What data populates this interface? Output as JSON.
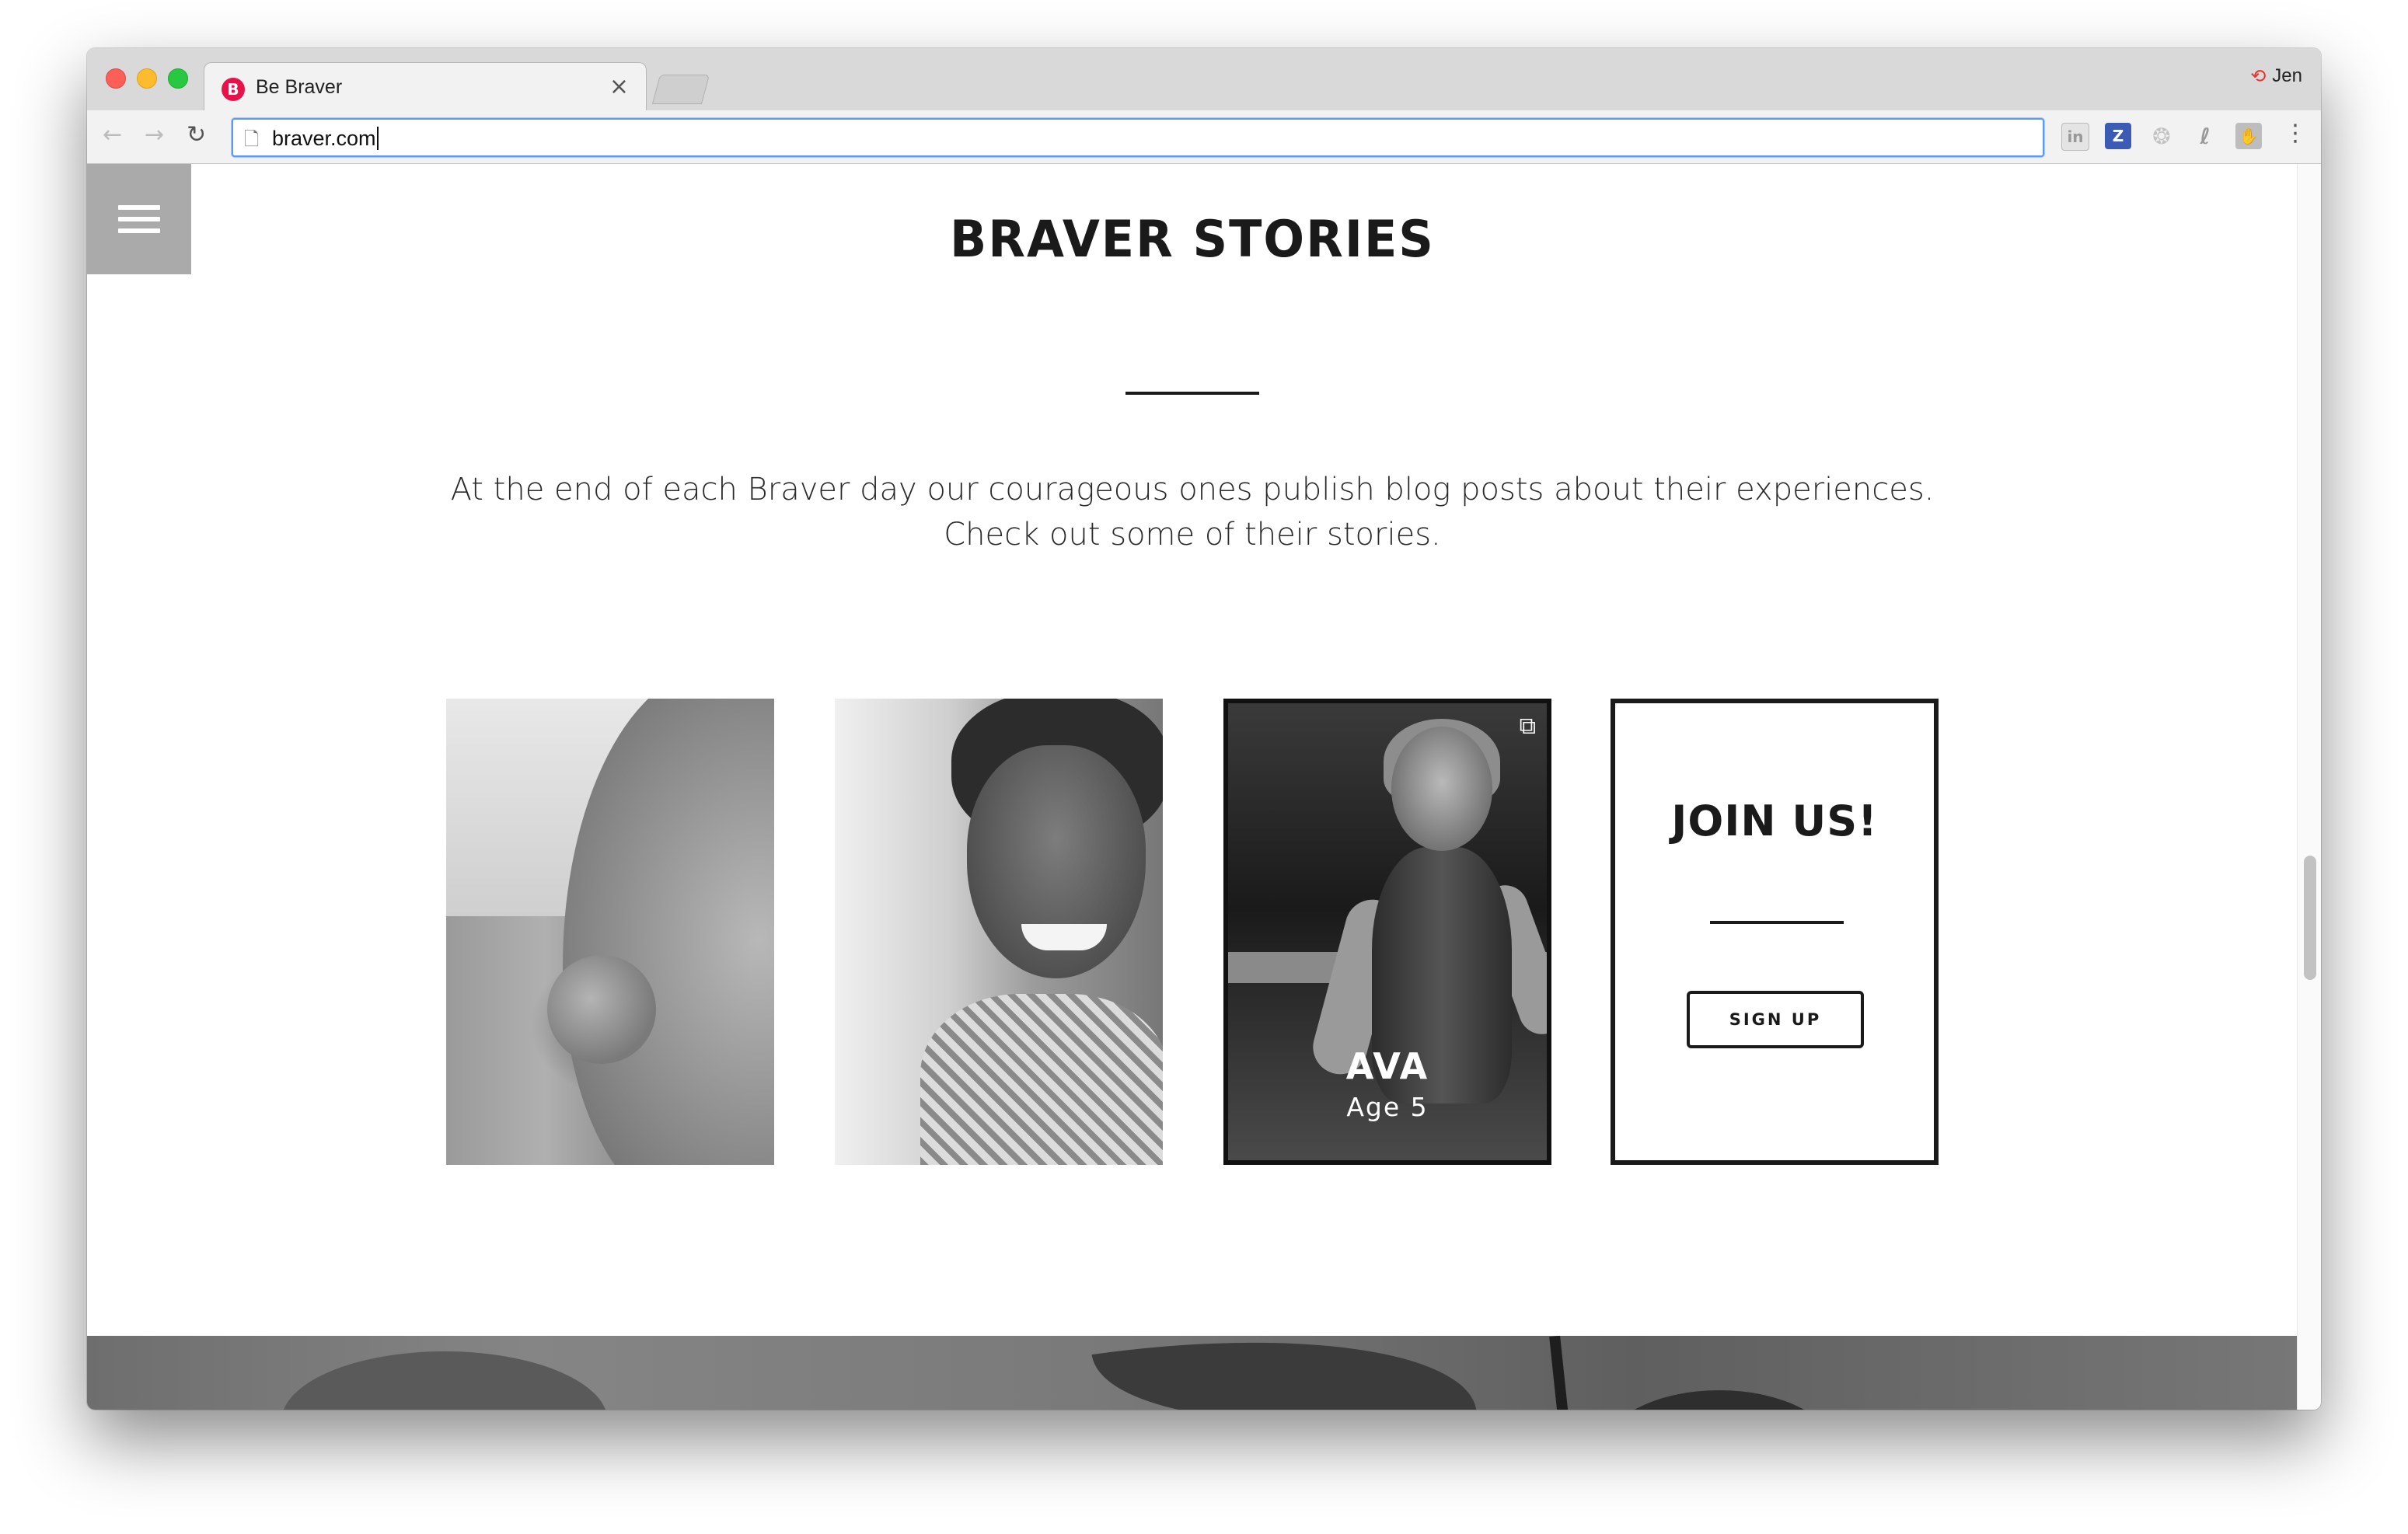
{
  "browser": {
    "tab_title": "Be Braver",
    "tab_favicon_letter": "B",
    "tab_close": "×",
    "profile_name": "Jen",
    "url": "braver.com"
  },
  "page": {
    "section_title": "BRAVER STORIES",
    "intro_line1": "At the end of each Braver day our courageous ones publish blog posts about their experiences.",
    "intro_line2": "Check out some of their stories.",
    "featured_card": {
      "name": "AVA",
      "age": "Age 5"
    },
    "join_card": {
      "title": "JOIN US!",
      "button": "SIGN UP"
    }
  },
  "colors": {
    "favicon": "#e8124b",
    "omnibox_focus": "#5b9af8",
    "hamburger_bg": "#aaaaaa",
    "text_dark": "#1a1a1a"
  },
  "icons": {
    "back": "arrow-left-icon",
    "forward": "arrow-right-icon",
    "reload": "reload-icon",
    "page": "page-icon",
    "menu": "hamburger-menu-icon",
    "external": "external-link-icon"
  }
}
